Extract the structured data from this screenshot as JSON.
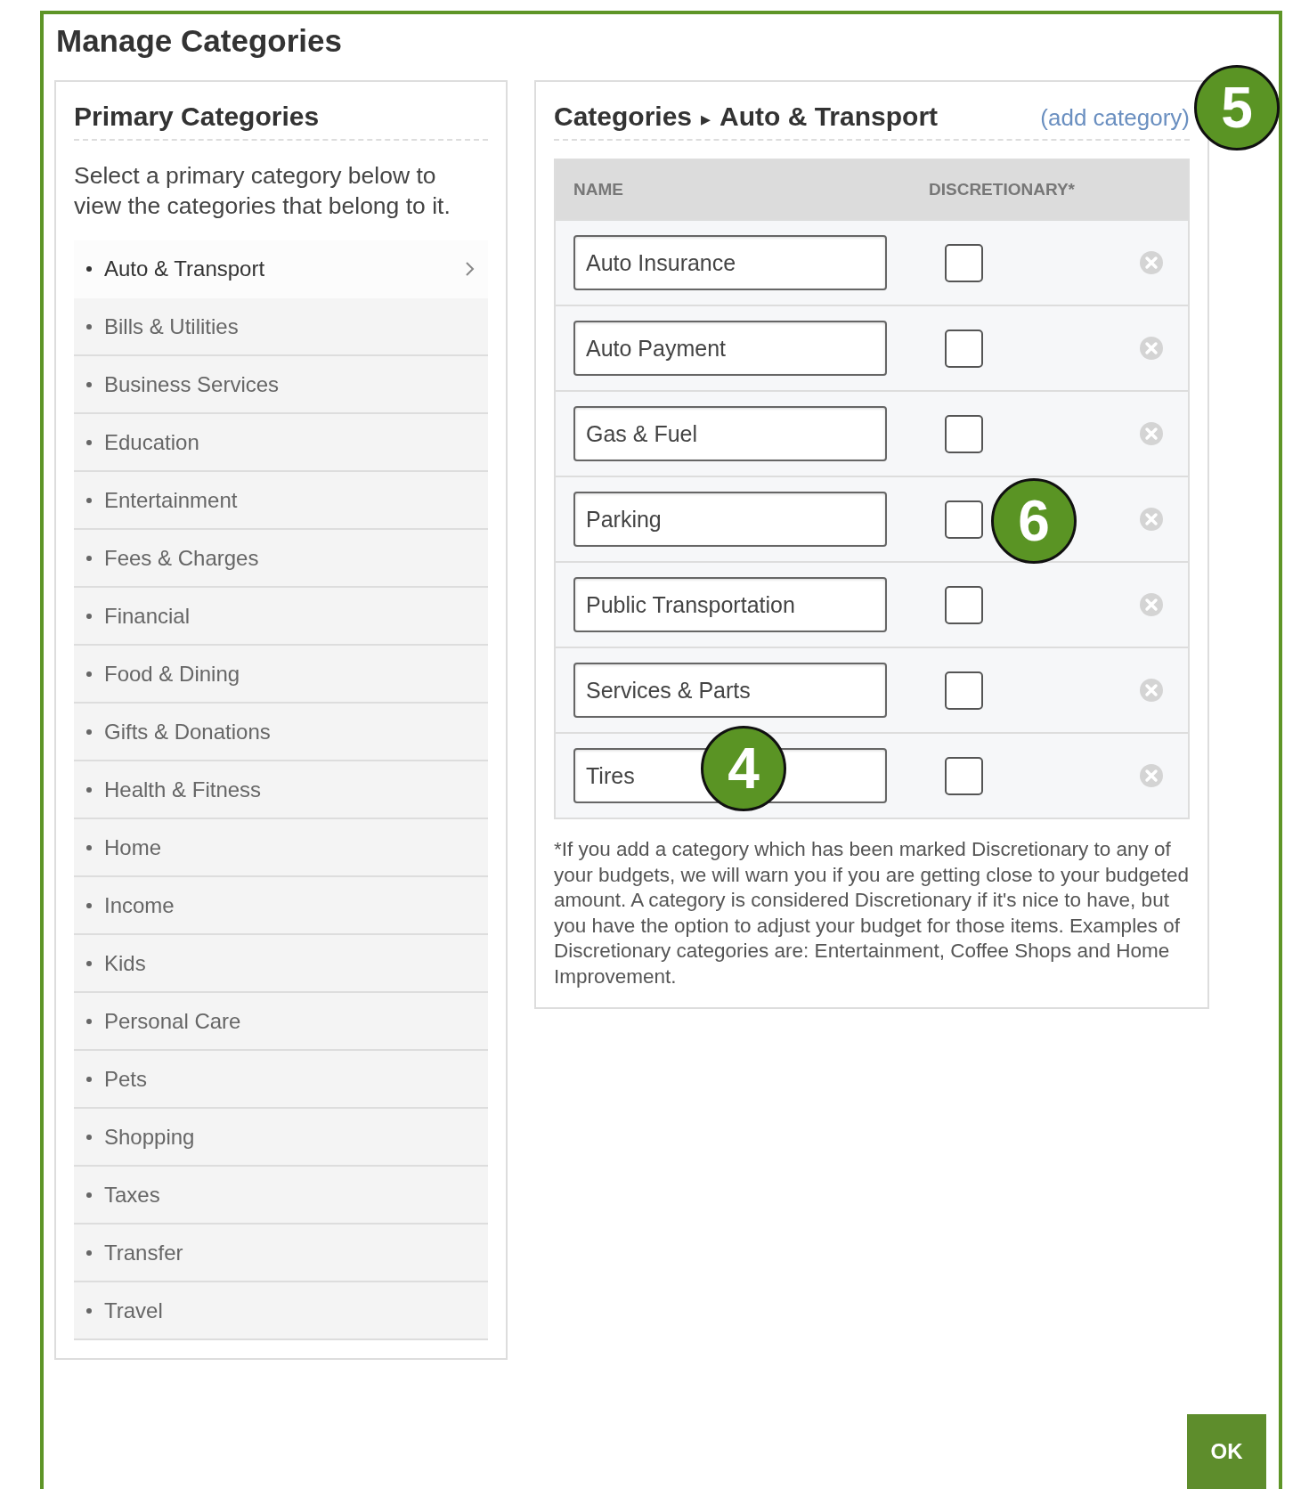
{
  "dialog": {
    "title": "Manage Categories"
  },
  "primary": {
    "heading": "Primary Categories",
    "description": "Select a primary category below to view the categories that belong to it.",
    "items": [
      {
        "label": "Auto & Transport",
        "selected": true
      },
      {
        "label": "Bills & Utilities",
        "selected": false
      },
      {
        "label": "Business Services",
        "selected": false
      },
      {
        "label": "Education",
        "selected": false
      },
      {
        "label": "Entertainment",
        "selected": false
      },
      {
        "label": "Fees & Charges",
        "selected": false
      },
      {
        "label": "Financial",
        "selected": false
      },
      {
        "label": "Food & Dining",
        "selected": false
      },
      {
        "label": "Gifts & Donations",
        "selected": false
      },
      {
        "label": "Health & Fitness",
        "selected": false
      },
      {
        "label": "Home",
        "selected": false
      },
      {
        "label": "Income",
        "selected": false
      },
      {
        "label": "Kids",
        "selected": false
      },
      {
        "label": "Personal Care",
        "selected": false
      },
      {
        "label": "Pets",
        "selected": false
      },
      {
        "label": "Shopping",
        "selected": false
      },
      {
        "label": "Taxes",
        "selected": false
      },
      {
        "label": "Transfer",
        "selected": false
      },
      {
        "label": "Travel",
        "selected": false
      }
    ]
  },
  "categories": {
    "breadcrumb_root": "Categories",
    "breadcrumb_separator": "▸",
    "breadcrumb_current": "Auto & Transport",
    "add_link": "(add category)",
    "columns": [
      "NAME",
      "DISCRETIONARY*"
    ],
    "rows": [
      {
        "name": "Auto Insurance",
        "discretionary": false
      },
      {
        "name": "Auto Payment",
        "discretionary": false
      },
      {
        "name": "Gas & Fuel",
        "discretionary": false
      },
      {
        "name": "Parking",
        "discretionary": false
      },
      {
        "name": "Public Transportation",
        "discretionary": false
      },
      {
        "name": "Services & Parts",
        "discretionary": false
      },
      {
        "name": "Tires",
        "discretionary": false
      }
    ],
    "footnote": "*If you add a category which has been marked Discretionary to any of your budgets, we will warn you if you are getting close to your budgeted amount. A category is considered Discretionary if it's nice to have, but you have the option to adjust your budget for those items. Examples of Discretionary categories are: Entertainment, Coffee Shops and Home Improvement."
  },
  "ok_button": "OK",
  "callouts": [
    {
      "label": "5"
    },
    {
      "label": "6"
    },
    {
      "label": "4"
    }
  ]
}
